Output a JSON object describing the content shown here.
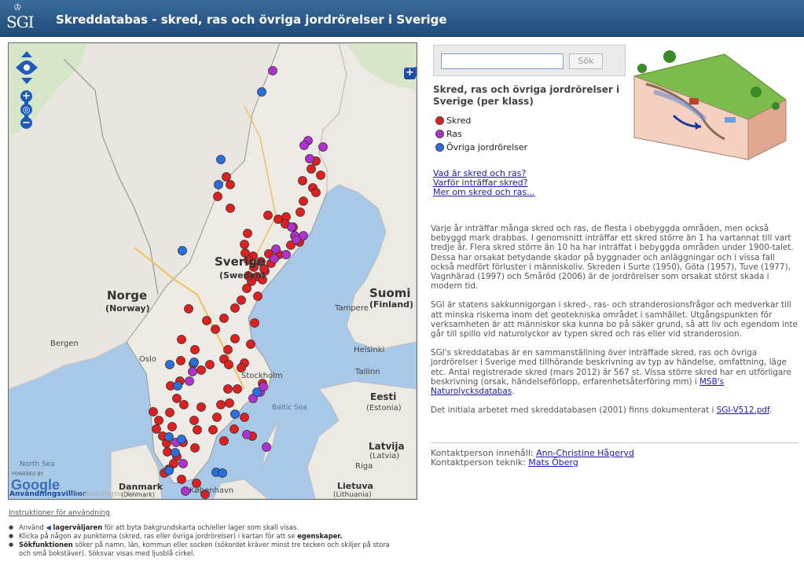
{
  "header": {
    "logo_text": "SGI",
    "title": "Skreddatabas - skred, ras och övriga jordrörelser i Sverige"
  },
  "colors": {
    "header": "#2e5e8e",
    "skred": "#e02020",
    "ras": "#b030d0",
    "ovriga": "#2a6fe0",
    "link": "#1a1aa8"
  },
  "map": {
    "labels": {
      "sverige": "Sverige",
      "sverige_sub": "(Sweden)",
      "norge": "Norge",
      "norge_sub": "(Norway)",
      "suomi": "Suomi",
      "suomi_sub": "(Finland)",
      "eesti": "Eesti",
      "eesti_sub": "(Estonia)",
      "latvija": "Latvija",
      "latvija_sub": "(Latvia)",
      "danmark": "Danmark",
      "danmark_sub": "(Denmark)",
      "lietuva": "Lietuva",
      "lietuva_sub": "(Lithuania)",
      "bergen": "Bergen",
      "oslo": "Oslo",
      "stockholm": "Stockholm",
      "helsinki": "Helsinki",
      "tallinn": "Tallinn",
      "tampere": "Tampere",
      "riga": "Riga",
      "kobenhavn": "København",
      "north_sea": "North Sea",
      "baltic_sea": "Baltic Sea"
    },
    "powered_by": "POWERED BY",
    "google": "Google",
    "terms": "Användningsvillkor",
    "terms_shadow": "Användningsvillkor",
    "icons": {
      "pan": "pan-arrows-icon",
      "zoom_in": "zoom-in-icon",
      "zoom_out": "zoom-out-icon",
      "globe": "globe-icon",
      "layers": "layer-switcher-icon"
    },
    "markers": {
      "skred": [
        [
          277,
          170
        ],
        [
          282,
          180
        ],
        [
          266,
          195
        ],
        [
          282,
          210
        ],
        [
          391,
          150
        ],
        [
          385,
          160
        ],
        [
          397,
          168
        ],
        [
          374,
          175
        ],
        [
          387,
          184
        ],
        [
          391,
          190
        ],
        [
          375,
          201
        ],
        [
          371,
          215
        ],
        [
          353,
          221
        ],
        [
          362,
          234
        ],
        [
          330,
          219
        ],
        [
          343,
          224
        ],
        [
          304,
          242
        ],
        [
          300,
          256
        ],
        [
          301,
          267
        ],
        [
          311,
          271
        ],
        [
          305,
          276
        ],
        [
          312,
          285
        ],
        [
          321,
          278
        ],
        [
          326,
          290
        ],
        [
          316,
          297
        ],
        [
          309,
          303
        ],
        [
          303,
          312
        ],
        [
          296,
          327
        ],
        [
          288,
          337
        ],
        [
          274,
          350
        ],
        [
          252,
          353
        ],
        [
          229,
          338
        ],
        [
          220,
          377
        ],
        [
          237,
          390
        ],
        [
          263,
          364
        ],
        [
          279,
          390
        ],
        [
          274,
          402
        ],
        [
          256,
          409
        ],
        [
          245,
          416
        ],
        [
          235,
          408
        ],
        [
          219,
          404
        ],
        [
          218,
          430
        ],
        [
          214,
          452
        ],
        [
          205,
          470
        ],
        [
          184,
          469
        ],
        [
          191,
          480
        ],
        [
          188,
          491
        ],
        [
          196,
          500
        ],
        [
          208,
          488
        ],
        [
          201,
          509
        ],
        [
          202,
          520
        ],
        [
          214,
          526
        ],
        [
          237,
          515
        ],
        [
          240,
          492
        ],
        [
          236,
          480
        ],
        [
          279,
          440
        ],
        [
          270,
          460
        ],
        [
          300,
          407
        ],
        [
          308,
          383
        ],
        [
          313,
          356
        ],
        [
          288,
          376
        ],
        [
          323,
          433
        ],
        [
          300,
          476
        ],
        [
          287,
          491
        ],
        [
          281,
          458
        ],
        [
          265,
          476
        ],
        [
          260,
          492
        ],
        [
          274,
          506
        ],
        [
          245,
          463
        ],
        [
          223,
          460
        ],
        [
          210,
          535
        ],
        [
          204,
          542
        ],
        [
          198,
          547
        ],
        [
          220,
          555
        ],
        [
          239,
          560
        ],
        [
          250,
          574
        ],
        [
          222,
          508
        ],
        [
          206,
          436
        ],
        [
          296,
          413
        ],
        [
          310,
          500
        ],
        [
          291,
          440
        ],
        [
          280,
          409
        ],
        [
          305,
          296
        ],
        [
          323,
          301
        ],
        [
          325,
          287
        ],
        [
          334,
          280
        ],
        [
          331,
          268
        ],
        [
          352,
          230
        ],
        [
          370,
          253
        ],
        [
          359,
          257
        ],
        [
          344,
          269
        ],
        [
          317,
          322
        ]
      ],
      "ras": [
        [
          336,
          35
        ],
        [
          381,
          124
        ],
        [
          383,
          147
        ],
        [
          376,
          130
        ],
        [
          400,
          132
        ],
        [
          360,
          234
        ],
        [
          364,
          245
        ],
        [
          375,
          245
        ],
        [
          366,
          250
        ],
        [
          353,
          269
        ],
        [
          338,
          274
        ],
        [
          340,
          262
        ],
        [
          234,
          418
        ],
        [
          230,
          430
        ],
        [
          320,
          444
        ],
        [
          324,
          437
        ],
        [
          303,
          498
        ],
        [
          311,
          452
        ],
        [
          213,
          508
        ],
        [
          222,
          535
        ],
        [
          328,
          514
        ],
        [
          225,
          570
        ]
      ],
      "ovriga": [
        [
          322,
          62
        ],
        [
          270,
          148
        ],
        [
          267,
          180
        ],
        [
          221,
          264
        ],
        [
          236,
          406
        ],
        [
          205,
          409
        ],
        [
          215,
          436
        ],
        [
          204,
          501
        ],
        [
          212,
          521
        ],
        [
          264,
          546
        ],
        [
          272,
          547
        ],
        [
          204,
          544
        ],
        [
          288,
          472
        ],
        [
          316,
          444
        ],
        [
          220,
          504
        ],
        [
          519,
          36
        ]
      ]
    }
  },
  "search": {
    "placeholder": "",
    "value": "",
    "button": "Sök"
  },
  "legend": {
    "title": "Skred, ras och övriga jordrörelser i Sverige (per klass)",
    "items": [
      {
        "label": "Skred"
      },
      {
        "label": "Ras"
      },
      {
        "label": "Övriga jordrörelser"
      }
    ]
  },
  "links": [
    "Vad är skred och ras?",
    "Varför inträffar skred?",
    "Mer om skred och ras..."
  ],
  "article": {
    "p1": "Varje år inträffar många skred och ras, de flesta i obebyggda områden, men också bebyggd mark drabbas. I genomsnitt inträffar ett skred större än 1 ha vartannat till vart tredje år. Flera skred större än 10 ha har inträffat i bebyggda områden under 1900-talet. Dessa har orsakat betydande skador på byggnader och anläggningar och i vissa fall också medfört förluster i människoliv. Skreden i Surte (1950), Göta (1957), Tuve (1977), Vagnhärad (1997) och Småröd (2006) är de jordrörelser som orsakat störst skada i modern tid.",
    "p2": "SGI är statens sakkunnigorgan i skred-, ras- och stranderosionsfrågor och medverkar till att minska riskerna inom det geotekniska området i samhället. Utgångspunkten för verksamheten är att människor ska kunna bo på säker grund, så att liv och egendom inte går till spillo vid naturolyckor av typen skred och ras eller vid stranderosion.",
    "p3_text": "SGI's skreddatabas är en sammanställning över inträffade skred, ras och övriga jordrörelser i Sverige med tillhörande beskrivning av typ av händelse, omfattning, läge etc. Antal registrerade skred (mars 2012) är 567 st. Vissa större skred har en utförligare beskrivning (orsak, händelseförlopp, erfarenhetsåterföring mm) i ",
    "p3_link": "MSB's Naturolycksdatabas",
    "p3_end": ".",
    "p4_text": "Det initiala arbetet med skreddatabasen (2001) finns dokumenterat i ",
    "p4_link": "SGI-V512.pdf",
    "p4_end": "."
  },
  "contact": {
    "content_label": "Kontaktperson innehåll: ",
    "content_name": "Ann-Christine Hågeryd",
    "tech_label": "Kontaktperson teknik: ",
    "tech_name": "Mats Öberg"
  },
  "instructions": {
    "title": "Instruktioner för användning",
    "i1_pre": "Använd ",
    "i1_bold": "lagerväljaren",
    "i1_post": " för att byta bakgrundskarta och/eller lager som skall visas.",
    "i2_pre": "Klicka på någon av punkterna (skred, ras eller övriga jordrörelser) i kartan för att se ",
    "i2_bold": "egenskaper.",
    "i3_bold": "Sökfunktionen",
    "i3_post": " söker på namn, län, kommun eller socken (sökordet kräver minst tre tecken och skiljer på stora och små bokstäver). Söksvar visas med ljusblå cirkel."
  }
}
